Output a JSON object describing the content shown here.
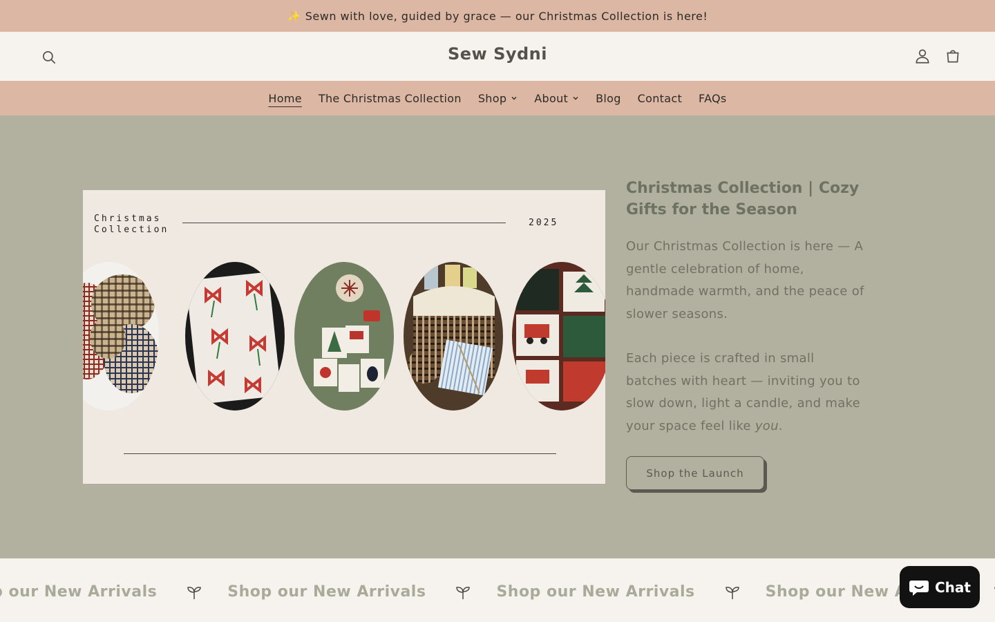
{
  "announcement": {
    "text": "✨ Sewn with love, guided by grace — our Christmas Collection is here!"
  },
  "header": {
    "logo": "Sew Sydni",
    "search_icon": "search-icon",
    "account_icon": "account-icon",
    "cart_icon": "cart-icon"
  },
  "nav": {
    "items": [
      {
        "label": "Home",
        "active": true,
        "dropdown": false
      },
      {
        "label": "The Christmas Collection",
        "dropdown": false
      },
      {
        "label": "Shop",
        "dropdown": true
      },
      {
        "label": "About",
        "dropdown": true
      },
      {
        "label": "Blog",
        "dropdown": false
      },
      {
        "label": "Contact",
        "dropdown": false
      },
      {
        "label": "FAQs",
        "dropdown": false
      }
    ]
  },
  "hero": {
    "collage": {
      "title_line1": "Christmas",
      "title_line2": "Collection",
      "year": "2025",
      "photos": [
        "scrunchies-photo",
        "bow-fabric-photo",
        "sweatshirt-photo",
        "basket-photo",
        "truck-fabric-photo"
      ]
    },
    "heading": "Christmas Collection | Cozy Gifts for the Season",
    "body_p1": "Our Christmas Collection is here — A gentle celebration of home, handmade warmth, and the peace of slower seasons.",
    "body_p2_main": "Each piece is crafted in small batches with heart — inviting you to slow down, light a candle, and make your space feel like ",
    "body_p2_em": "you",
    "body_p2_end": ".",
    "cta": "Shop the Launch"
  },
  "marquee": {
    "text": "Shop our New Arrivals",
    "icon": "sprout-icon"
  },
  "chat": {
    "label": "Chat",
    "icon": "chat-bubble-icon"
  },
  "colors": {
    "announcement_bg": "#dbb7a4",
    "hero_bg": "#b2b19f",
    "page_bg": "#f6f3ef",
    "chat_bg": "#121212"
  }
}
